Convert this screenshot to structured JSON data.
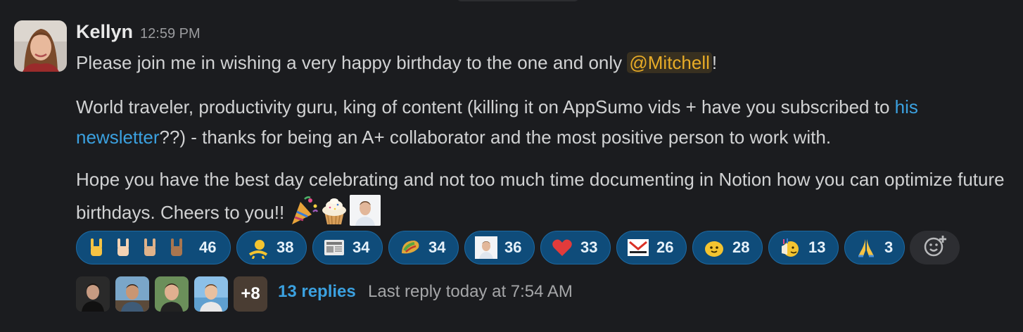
{
  "message": {
    "author": "Kellyn",
    "timestamp": "12:59 PM",
    "paragraph1": {
      "before": "Please join me in wishing a very happy birthday to the one and only ",
      "mention": "@Mitchell",
      "after": "!"
    },
    "paragraph2": {
      "before": "World traveler, productivity guru, king of content (killing it on AppSumo vids + have you subscribed to ",
      "link": "his newsletter",
      "after": "??) - thanks for being an A+ collaborator and the most positive person to work with."
    },
    "paragraph3": {
      "text": "Hope you have the best day celebrating and not too much time documenting in Notion how you can optimize future birthdays. Cheers to you!! ",
      "emojis": [
        "party-popper-icon",
        "cupcake-icon",
        "person-photo-icon"
      ]
    }
  },
  "reactions": [
    {
      "icon": "rock-on-hands-icon",
      "count": "46"
    },
    {
      "icon": "dancing-figure-icon",
      "count": "38"
    },
    {
      "icon": "newspaper-icon",
      "count": "34"
    },
    {
      "icon": "taco-icon",
      "count": "34"
    },
    {
      "icon": "person-photo-icon",
      "count": "36"
    },
    {
      "icon": "heart-icon",
      "count": "33"
    },
    {
      "icon": "mail-logo-icon",
      "count": "26"
    },
    {
      "icon": "blob-emoji-icon",
      "count": "28"
    },
    {
      "icon": "cake-face-icon",
      "count": "13"
    },
    {
      "icon": "pray-icon",
      "count": "3"
    }
  ],
  "add_reaction_icon": "add-reaction-icon",
  "thread": {
    "more_count": "+8",
    "replies": "13 replies",
    "last_reply": "Last reply today at 7:54 AM"
  },
  "colors": {
    "background": "#1b1c1f",
    "mention": "#e8ac27",
    "link": "#3ba1e0",
    "reaction_bg": "#0f4c7a"
  }
}
